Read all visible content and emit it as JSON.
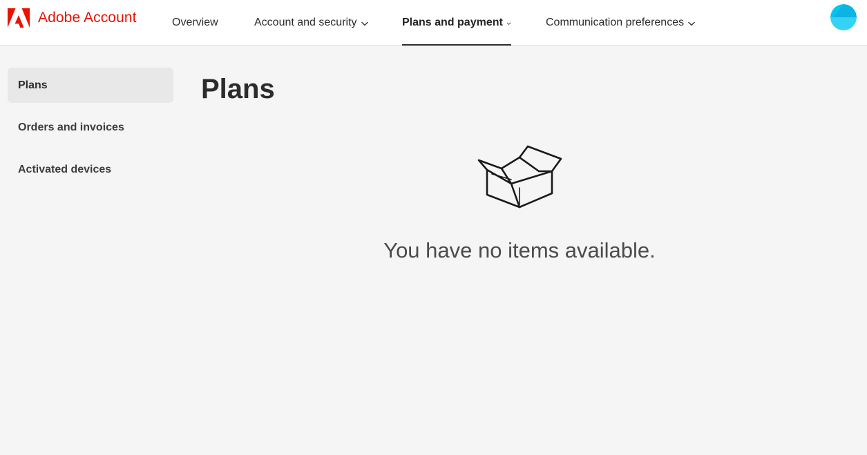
{
  "header": {
    "brand_name": "Adobe Account",
    "brand_color": "#eb1000",
    "nav": [
      {
        "label": "Overview",
        "has_dropdown": false,
        "active": false
      },
      {
        "label": "Account and security",
        "has_dropdown": true,
        "active": false
      },
      {
        "label": "Plans and payment",
        "has_dropdown": true,
        "active": true
      },
      {
        "label": "Communication preferences",
        "has_dropdown": true,
        "active": false
      }
    ],
    "avatar_colors": [
      "#00c6f0",
      "#1aa3d9"
    ]
  },
  "sidebar": {
    "items": [
      {
        "label": "Plans",
        "selected": true
      },
      {
        "label": "Orders and invoices",
        "selected": false
      },
      {
        "label": "Activated devices",
        "selected": false
      }
    ]
  },
  "main": {
    "title": "Plans",
    "empty_state": {
      "icon": "open-box-icon",
      "message": "You have no items available."
    }
  }
}
